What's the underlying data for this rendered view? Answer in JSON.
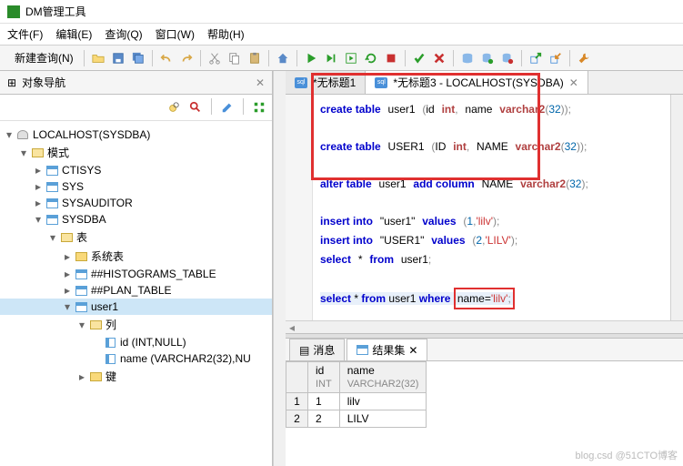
{
  "window": {
    "title": "DM管理工具"
  },
  "menu": {
    "file": "文件(F)",
    "edit": "编辑(E)",
    "query": "查询(Q)",
    "window": "窗口(W)",
    "help": "帮助(H)"
  },
  "toolbar": {
    "new_query": "新建查询(N)"
  },
  "sidebar": {
    "tab_title": "对象导航",
    "tree": {
      "root": "LOCALHOST(SYSDBA)",
      "schema": "模式",
      "schemas": [
        "CTISYS",
        "SYS",
        "SYSAUDITOR",
        "SYSDBA"
      ],
      "tables_node": "表",
      "system_tables": "系统表",
      "tables": [
        "##HISTOGRAMS_TABLE",
        "##PLAN_TABLE",
        "user1"
      ],
      "columns_node": "列",
      "columns": [
        "id (INT,NULL)",
        "name (VARCHAR2(32),NU"
      ],
      "keys_node": "键"
    }
  },
  "editor": {
    "tabs": [
      {
        "label": "*无标题1"
      },
      {
        "label": "*无标题3 - LOCALHOST(SYSDBA)"
      }
    ],
    "sql": {
      "l1": {
        "a": "create table",
        "b": "user1",
        "c": "(",
        "d": "id",
        "e": "int",
        "f": ",",
        "g": "name",
        "h": "varchar2",
        "i": "(",
        "j": "32",
        "k": "));"
      },
      "l2": {
        "a": "create table",
        "b": "USER1",
        "c": "(",
        "d": "ID",
        "e": "int",
        "f": ",",
        "g": "NAME",
        "h": "varchar2",
        "i": "(",
        "j": "32",
        "k": "));"
      },
      "l3": {
        "a": "alter table",
        "b": "user1",
        "c": "add column",
        "d": "NAME",
        "e": "varchar2",
        "f": "(",
        "g": "32",
        "h": ");"
      },
      "l4": {
        "a": "insert into",
        "b": "\"user1\"",
        "c": "values",
        "d": "(",
        "e": "1",
        "f": ",",
        "g": "'lilv'",
        "h": ");"
      },
      "l5": {
        "a": "insert into",
        "b": "\"USER1\"",
        "c": "values",
        "d": "(",
        "e": "2",
        "f": ",",
        "g": "'LILV'",
        "h": ");"
      },
      "l6": {
        "a": "select",
        "b": "*",
        "c": "from",
        "d": "user1",
        "e": ";"
      },
      "l7": {
        "a": "select",
        "b": "*",
        "c": "from",
        "d": "user1",
        "e": "where",
        "f": "name=",
        "g": "'lilv'",
        "h": ";"
      }
    }
  },
  "results": {
    "tabs": {
      "messages": "消息",
      "resultset": "结果集"
    },
    "columns": [
      {
        "name": "id",
        "type": "INT"
      },
      {
        "name": "name",
        "type": "VARCHAR2(32)"
      }
    ],
    "rows": [
      {
        "n": "1",
        "id": "1",
        "name": "lilv"
      },
      {
        "n": "2",
        "id": "2",
        "name": "LILV"
      }
    ]
  },
  "watermark": "blog.csd @51CTO博客"
}
